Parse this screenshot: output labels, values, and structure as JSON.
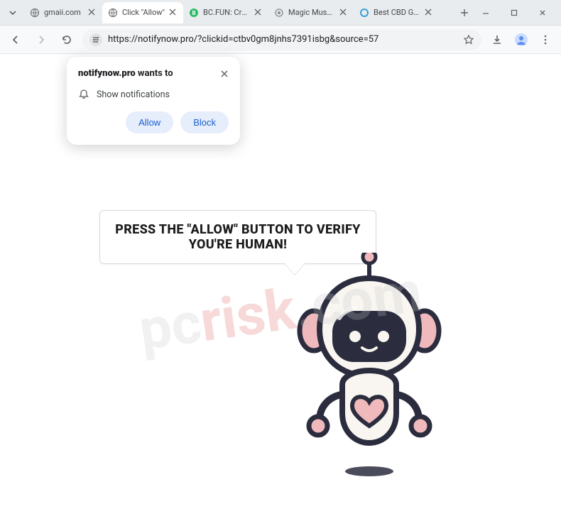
{
  "window": {
    "tabs": [
      {
        "title": "gmaii.com",
        "favicon": "globe",
        "active": false
      },
      {
        "title": "Click \"Allow\"",
        "favicon": "globe",
        "active": true
      },
      {
        "title": "BC.FUN: Crypto",
        "favicon": "bc",
        "active": false
      },
      {
        "title": "Magic Mushroo",
        "favicon": "dot",
        "active": false
      },
      {
        "title": "Best CBD Gumm",
        "favicon": "ring",
        "active": false
      }
    ],
    "url": "https://notifynow.pro/?clickid=ctbv0gm8jnhs7391isbg&source=57"
  },
  "permission_prompt": {
    "origin": "notifynow.pro",
    "wants_to": " wants to",
    "capability": "Show notifications",
    "allow": "Allow",
    "block": "Block"
  },
  "page": {
    "bubble_text": "PRESS THE \"ALLOW\" BUTTON TO VERIFY YOU'RE HUMAN!"
  },
  "watermark": {
    "pc": "pc",
    "risk": "risk",
    "tld": ".com"
  },
  "colors": {
    "chrome_bg": "#e8ecef",
    "accent_pill": "#e6edfb",
    "accent_text": "#1a5fd0",
    "robot_dark": "#2b2d3e",
    "robot_pink": "#f0b9bc",
    "robot_offwhite": "#f9f6f1"
  }
}
